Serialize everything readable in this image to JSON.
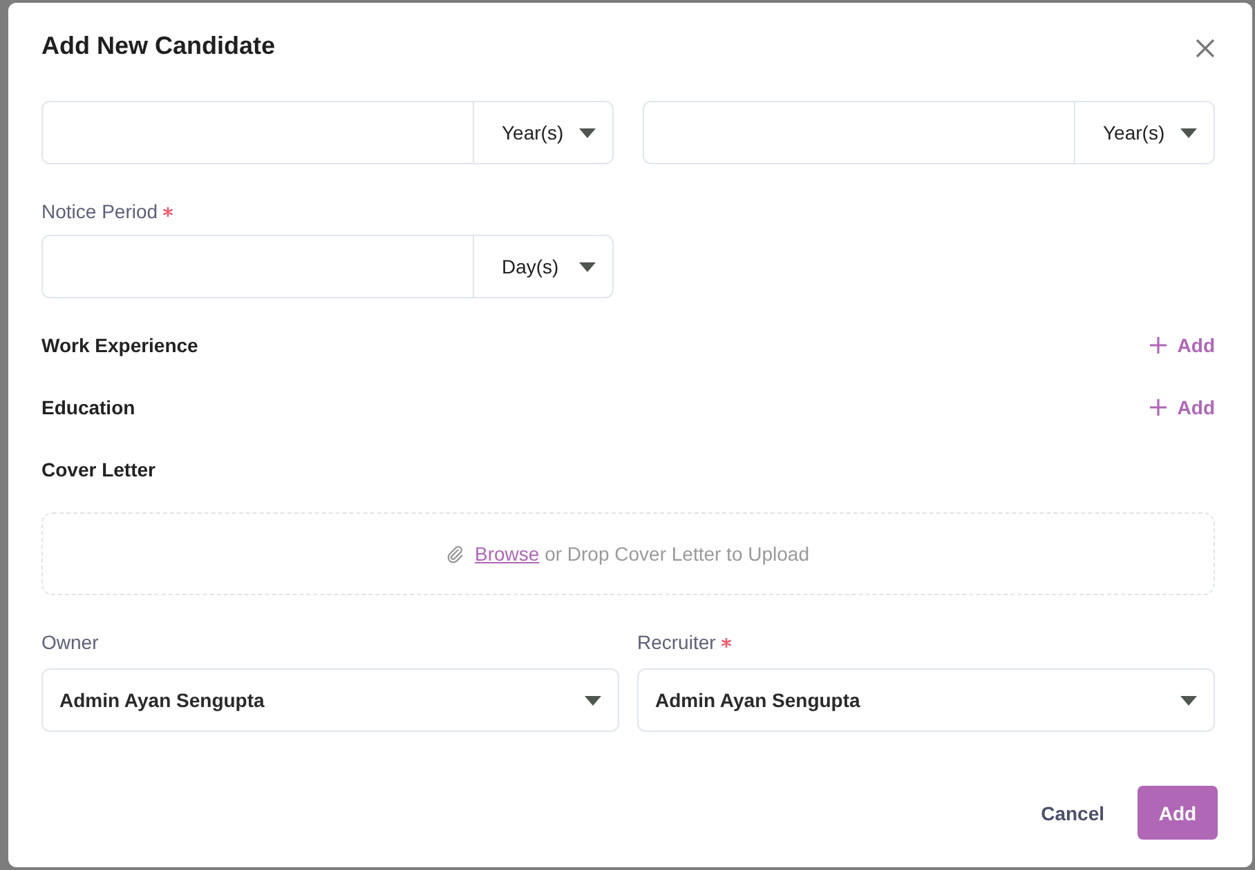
{
  "dialog": {
    "title": "Add New Candidate"
  },
  "experience_fields": [
    {
      "unit": "Year(s)"
    },
    {
      "unit": "Year(s)"
    }
  ],
  "notice_period": {
    "label": "Notice Period",
    "required": true,
    "unit": "Day(s)"
  },
  "sections": [
    {
      "title": "Work Experience",
      "action": "Add"
    },
    {
      "title": "Education",
      "action": "Add"
    },
    {
      "title": "Cover Letter"
    }
  ],
  "cover_letter_upload": {
    "link": "Browse",
    "text": "or Drop Cover Letter to Upload"
  },
  "assignees": [
    {
      "label": "Owner",
      "required": false,
      "value": "Admin Ayan Sengupta"
    },
    {
      "label": "Recruiter",
      "required": true,
      "value": "Admin Ayan Sengupta"
    }
  ],
  "buttons": {
    "cancel": "Cancel",
    "submit": "Add"
  }
}
